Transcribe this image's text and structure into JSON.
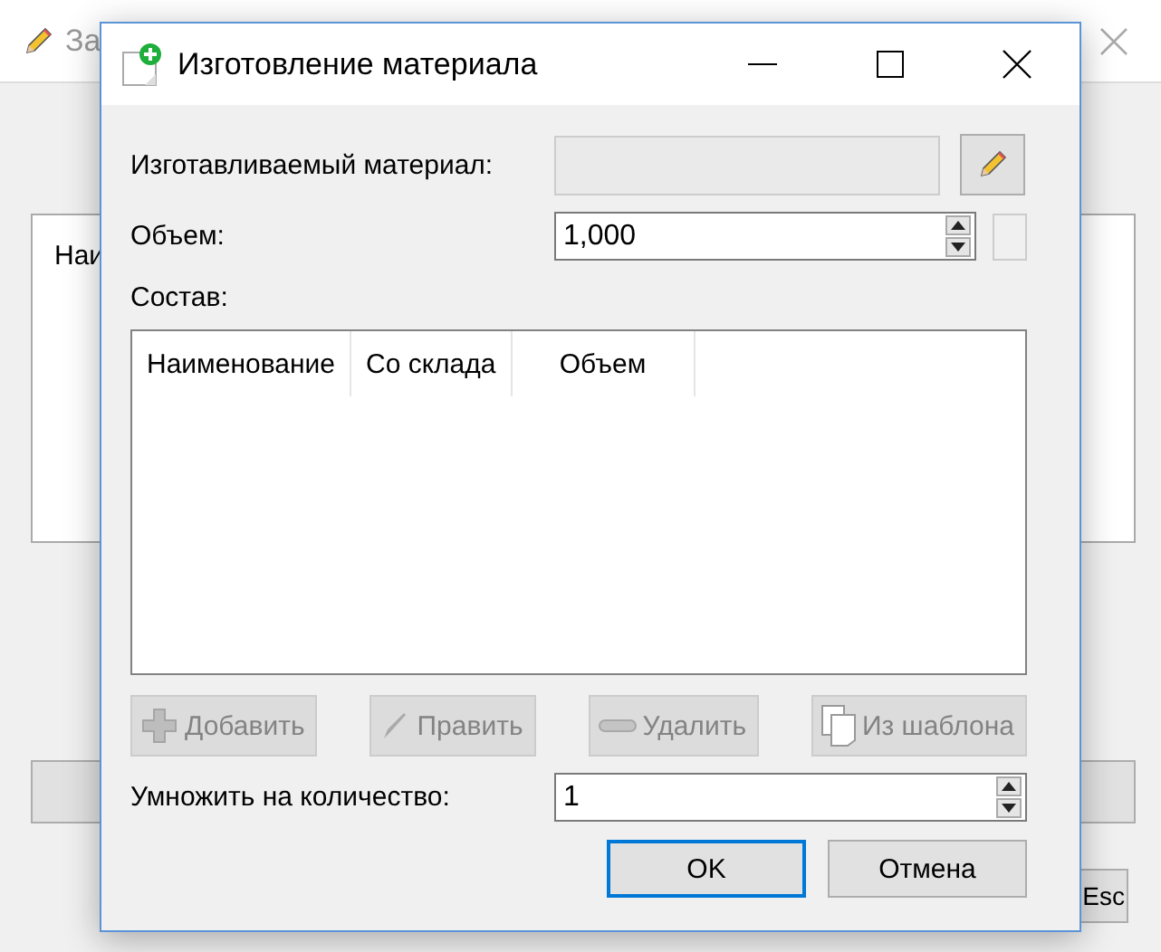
{
  "background_window": {
    "title": "За",
    "list_header": "Наи",
    "shortcut_button": "Esc"
  },
  "dialog": {
    "title": "Изготовление материала",
    "material": {
      "label": "Изготавливаемый материал:",
      "disabled": true
    },
    "volume": {
      "label": "Объем:",
      "value": "1,000"
    },
    "composition": {
      "label": "Состав:",
      "columns": [
        "Наименование",
        "Со склада",
        "Объем"
      ]
    },
    "actions": [
      {
        "kind": "add",
        "label": "Добавить",
        "disabled": true
      },
      {
        "kind": "edit",
        "label": "Править",
        "disabled": true
      },
      {
        "kind": "delete",
        "label": "Удалить",
        "disabled": true
      },
      {
        "kind": "template",
        "label": "Из шаблона",
        "disabled": true
      }
    ],
    "multiply": {
      "label": "Умножить на количество:",
      "value": "1"
    },
    "buttons": [
      {
        "label": "OK",
        "default": true
      },
      {
        "label": "Отмена",
        "default": false
      }
    ]
  }
}
